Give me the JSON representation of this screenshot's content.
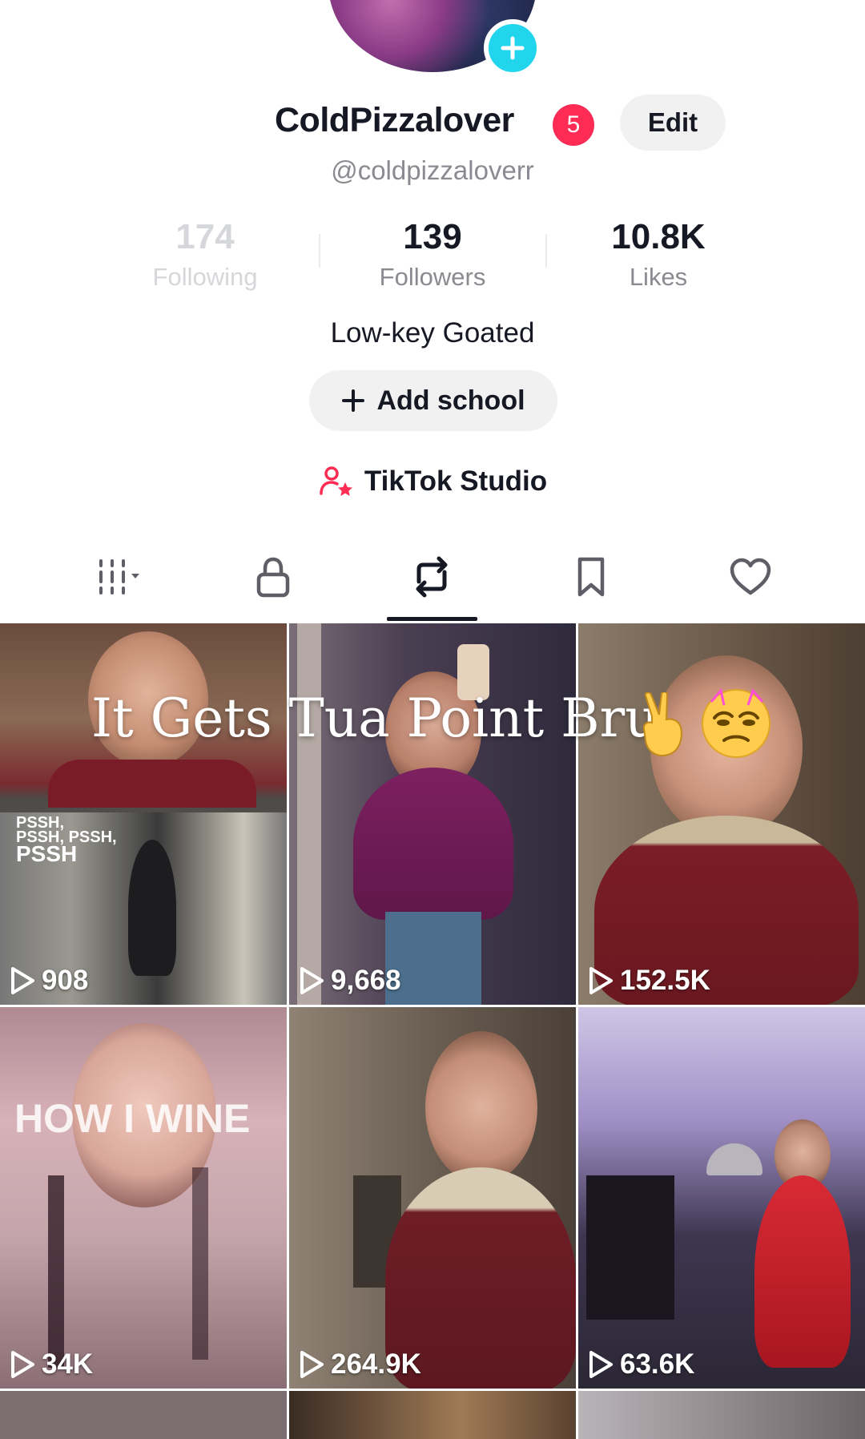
{
  "profile": {
    "display_name": "ColdPizzalover",
    "badge_count": "5",
    "edit_label": "Edit",
    "username": "@coldpizzaloverr",
    "bio": "Low-key Goated",
    "add_school_label": "Add school",
    "studio_label": "TikTok Studio"
  },
  "stats": [
    {
      "value": "174",
      "label": "Following"
    },
    {
      "value": "139",
      "label": "Followers"
    },
    {
      "value": "10.8K",
      "label": "Likes"
    }
  ],
  "tabs": [
    {
      "icon": "grid-icon",
      "active": false
    },
    {
      "icon": "lock-icon",
      "active": false
    },
    {
      "icon": "repost-icon",
      "active": true
    },
    {
      "icon": "bookmark-icon",
      "active": false
    },
    {
      "icon": "heart-icon",
      "active": false
    }
  ],
  "videos": [
    {
      "views": "908",
      "overlay": "PSSH, PSSH, PSSH, PSSH"
    },
    {
      "views": "9,668"
    },
    {
      "views": "152.5K"
    },
    {
      "views": "34K",
      "overlay": "HOW I WINE"
    },
    {
      "views": "264.9K"
    },
    {
      "views": "63.6K"
    }
  ],
  "caption_overlay": "It Gets Tua Point Bru",
  "colors": {
    "accent_red": "#fe2c55",
    "accent_cyan": "#20d5ec",
    "text_primary": "#161823",
    "text_secondary": "#8a8b91"
  }
}
